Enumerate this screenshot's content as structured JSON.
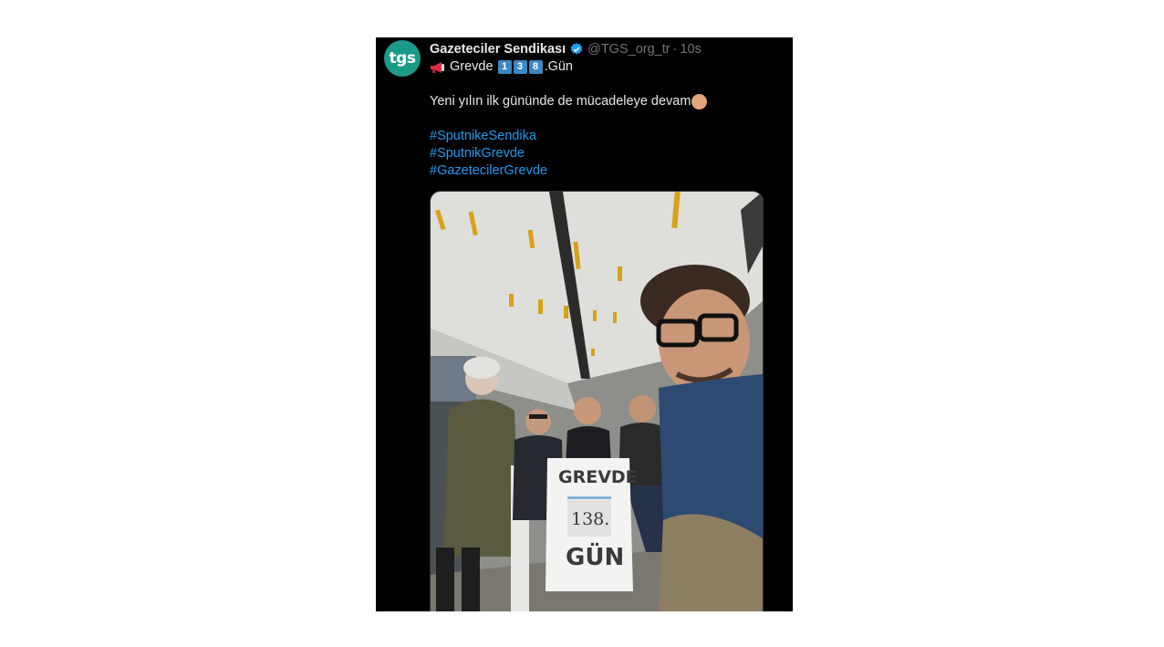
{
  "tweet": {
    "author": {
      "avatar_text": "tgs",
      "name": "Gazeteciler Sendikası",
      "verified_icon": "verified-badge-icon",
      "handle": "@TGS_org_tr",
      "separator": "·",
      "time": "10s"
    },
    "text": {
      "line1_prefix_icon": "megaphone-emoji",
      "line1_word": "Grevde",
      "line1_digits": [
        "1",
        "3",
        "8"
      ],
      "line1_suffix": ".Gün",
      "line2": "Yeni yılın ilk gününde de mücadeleye devam",
      "line2_suffix_icon": "raised-fist-emoji",
      "hashtags": [
        "#SputnikeSendika",
        "#SputnikGrevde",
        "#GazetecilerGrevde"
      ]
    },
    "media": {
      "sign_top": "GREVDE",
      "sign_number": "138.",
      "sign_bottom": "GÜN"
    }
  },
  "colors": {
    "background": "#000000",
    "text": "#e7e9ea",
    "muted": "#71767b",
    "link": "#1d9bf0",
    "avatar": "#1b9a8a",
    "verified": "#1d9bf0"
  }
}
